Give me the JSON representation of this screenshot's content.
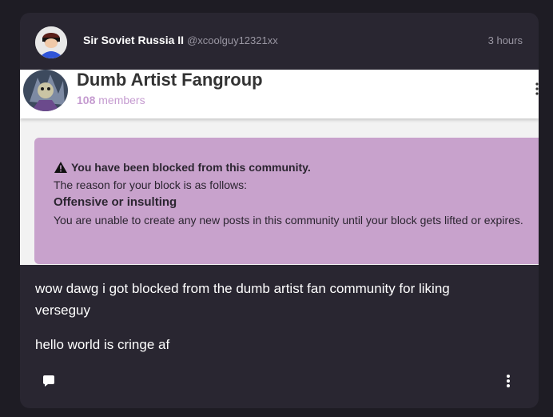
{
  "post": {
    "author_name": "Sir Soviet Russia II",
    "author_handle": "@xcoolguy12321xx",
    "timestamp": "3 hours",
    "body": [
      "wow dawg i got blocked from the dumb artist fan community for liking verseguy",
      "hello world is cringe af"
    ]
  },
  "embed": {
    "community_name": "Dumb Artist Fangroup",
    "member_count": "108",
    "member_label": "members",
    "notice": {
      "title": "You have been blocked from this community.",
      "reason_label": "The reason for your block is as follows:",
      "reason": "Offensive or insulting",
      "info": "You are unable to create any new posts in this community until your block gets lifted or expires."
    }
  },
  "icons": {
    "comment": "comment-icon",
    "more": "more-vertical-icon",
    "warning": "warning-icon"
  },
  "colors": {
    "background": "#1e1c24",
    "card": "#292631",
    "notice_bg": "#c8a2cc",
    "member_accent": "#c59bd0"
  }
}
